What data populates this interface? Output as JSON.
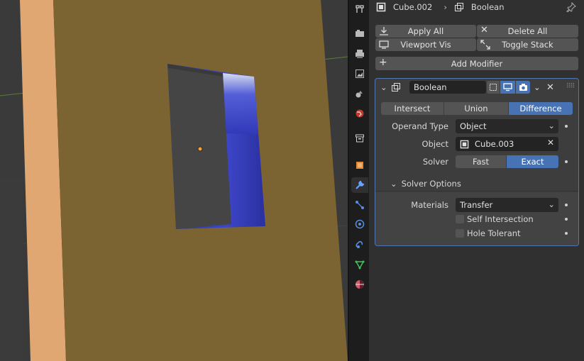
{
  "header": {
    "object_name": "Cube.002",
    "modifier_name": "Boolean"
  },
  "stack_buttons": {
    "apply_all": "Apply All",
    "delete_all": "Delete All",
    "viewport_vis": "Viewport Vis",
    "toggle_stack": "Toggle Stack",
    "add_modifier": "Add Modifier"
  },
  "modifier": {
    "name": "Boolean",
    "operations": [
      "Intersect",
      "Union",
      "Difference"
    ],
    "active_operation": "Difference",
    "operand_type": {
      "label": "Operand Type",
      "value": "Object"
    },
    "object": {
      "label": "Object",
      "value": "Cube.003"
    },
    "solver": {
      "label": "Solver",
      "options": [
        "Fast",
        "Exact"
      ],
      "active": "Exact"
    },
    "solver_options": {
      "title": "Solver Options",
      "materials": {
        "label": "Materials",
        "value": "Transfer"
      },
      "self_intersection": {
        "label": "Self Intersection",
        "checked": false
      },
      "hole_tolerant": {
        "label": "Hole Tolerant",
        "checked": false
      }
    }
  },
  "colors": {
    "accent": "#4772b3",
    "panel_bg": "#303030",
    "field_bg": "#232323",
    "button_bg": "#545454",
    "viewport_face": "#7a6331",
    "active_border": "#4f77b4"
  },
  "icons": {
    "tabs": [
      "tool-icon",
      "render-icon",
      "output-icon",
      "view-layer-icon",
      "scene-icon",
      "world-icon",
      "collection-icon",
      "object-icon",
      "modifier-wrench-icon",
      "particles-icon",
      "physics-icon",
      "constraints-icon",
      "object-data-icon",
      "material-icon"
    ]
  }
}
